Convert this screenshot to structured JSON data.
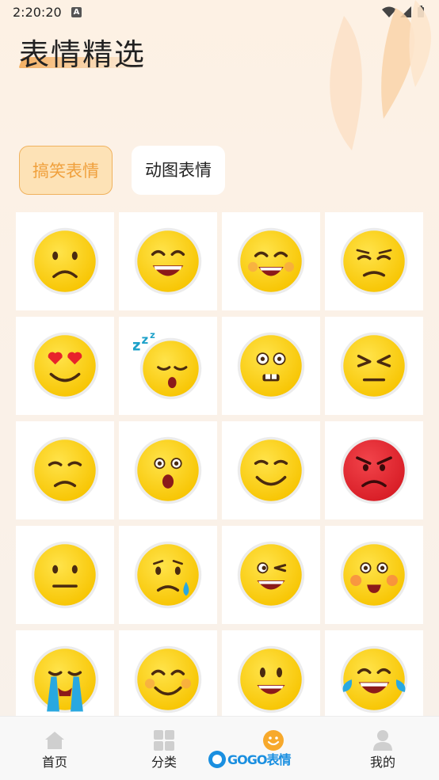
{
  "status_bar": {
    "time": "2:20:20",
    "indicator": "A"
  },
  "header": {
    "title": "表情精选"
  },
  "tabs": [
    {
      "label": "搞笑表情",
      "active": true
    },
    {
      "label": "动图表情",
      "active": false
    }
  ],
  "emoji_grid": [
    "sad-face",
    "grinning-face",
    "laughing-face",
    "smug-face",
    "heart-eyes-face",
    "sleeping-face",
    "bucktooth-face",
    "squinting-face",
    "unamused-face",
    "surprised-face",
    "content-smile-face",
    "angry-red-face",
    "neutral-face",
    "crying-sweat-face",
    "winking-face",
    "flushed-face",
    "loudly-crying-face",
    "blushing-smile-face",
    "happy-face",
    "tears-of-joy-face"
  ],
  "bottom_nav": [
    {
      "label": "首页",
      "icon": "home-icon",
      "active": false
    },
    {
      "label": "分类",
      "icon": "grid-icon",
      "active": false
    },
    {
      "label": "",
      "icon": "smiley-icon",
      "active": true
    },
    {
      "label": "我的",
      "icon": "profile-icon",
      "active": false
    }
  ],
  "watermark": {
    "text": "GOGO表情"
  },
  "colors": {
    "accent": "#f0a03c",
    "emoji_yellow": "#fcd10a",
    "angry_red": "#e52830",
    "tab_active_bg": "#fde2b6"
  }
}
